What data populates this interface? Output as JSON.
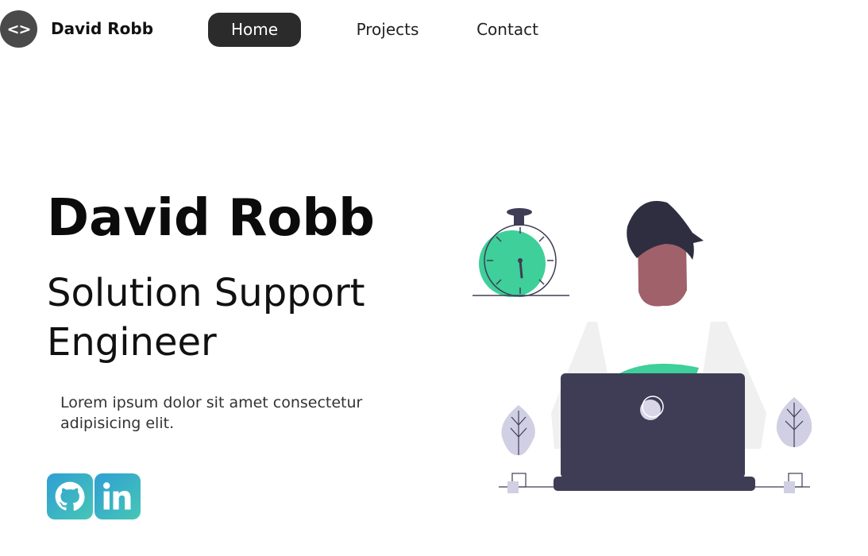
{
  "nav": {
    "logo_glyph": "<>",
    "brand": "David Robb",
    "links": [
      {
        "label": "Home",
        "active": true
      },
      {
        "label": "Projects",
        "active": false
      },
      {
        "label": "Contact",
        "active": false
      }
    ]
  },
  "hero": {
    "name": "David Robb",
    "role": "Solution Support Engineer",
    "description": "Lorem ipsum dolor sit amet consectetur adipisicing elit."
  },
  "social": [
    {
      "icon": "github-icon"
    },
    {
      "icon": "linkedin-icon"
    }
  ],
  "colors": {
    "accent": "#3ecf9a",
    "nav_active_bg": "#2b2b2b",
    "laptop": "#3f3d56",
    "skin": "#a0616a",
    "social_gradient_start": "#2f9fd4",
    "social_gradient_end": "#46c6b6"
  }
}
